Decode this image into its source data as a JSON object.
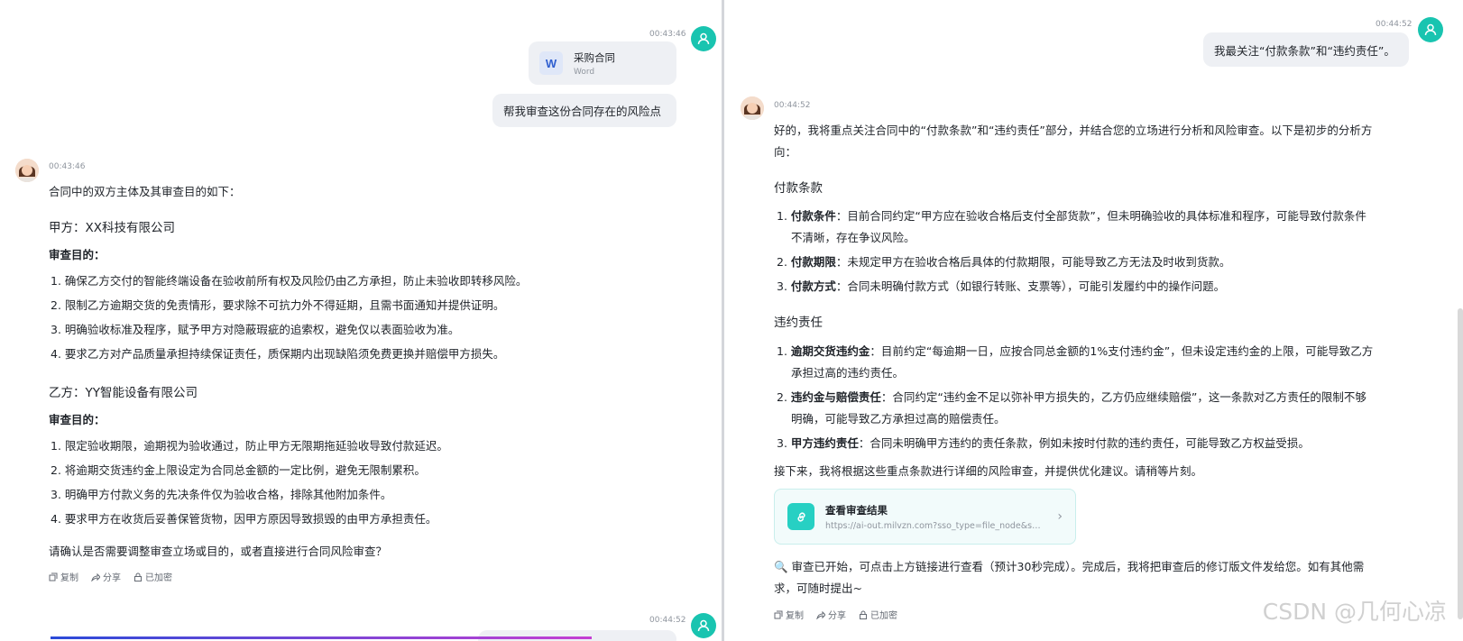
{
  "left": {
    "user_time_1": "00:43:46",
    "file": {
      "icon_letter": "W",
      "name": "采购合同",
      "type": "Word"
    },
    "user_message": "帮我审查这份合同存在的风险点",
    "bot_time": "00:43:46",
    "intro": "合同中的双方主体及其审查目的如下：",
    "party_a": {
      "heading": "甲方：XX科技有限公司",
      "purpose_label": "审查目的：",
      "items": [
        "确保乙方交付的智能终端设备在验收前所有权及风险仍由乙方承担，防止未验收即转移风险。",
        "限制乙方逾期交货的免责情形，要求除不可抗力外不得延期，且需书面通知并提供证明。",
        "明确验收标准及程序，赋予甲方对隐蔽瑕疵的追索权，避免仅以表面验收为准。",
        "要求乙方对产品质量承担持续保证责任，质保期内出现缺陷须免费更换并赔偿甲方损失。"
      ]
    },
    "party_b": {
      "heading": "乙方：YY智能设备有限公司",
      "purpose_label": "审查目的：",
      "items": [
        "限定验收期限，逾期视为验收通过，防止甲方无限期拖延验收导致付款延迟。",
        "将逾期交货违约金上限设定为合同总金额的一定比例，避免无限制累积。",
        "明确甲方付款义务的先决条件仅为验收合格，排除其他附加条件。",
        "要求甲方在收货后妥善保管货物，因甲方原因导致损毁的由甲方承担责任。"
      ]
    },
    "closing": "请确认是否需要调整审查立场或目的，或者直接进行合同风险审查？",
    "actions": {
      "copy": "复制",
      "share": "分享",
      "encrypted": "已加密"
    },
    "user_time_2": "00:44:52"
  },
  "right": {
    "user_time": "00:44:52",
    "user_message": "我最关注“付款条款”和“违约责任”。",
    "bot_time": "00:44:52",
    "intro_line1": "好的，我将重点关注合同中的“付款条款”和“违约责任”部分，并结合您的立场进行分析和风险审查。以下是初步的分析方",
    "intro_line2": "向：",
    "section1": {
      "heading": "付款条款",
      "items": [
        {
          "label": "付款条件",
          "line1": "：目前合同约定“甲方应在验收合格后支付全部货款”，但未明确验收的具体标准和程序，可能导致付款条件",
          "line2": "不清晰，存在争议风险。"
        },
        {
          "label": "付款期限",
          "line1": "：未规定甲方在验收合格后具体的付款期限，可能导致乙方无法及时收到货款。",
          "line2": ""
        },
        {
          "label": "付款方式",
          "line1": "：合同未明确付款方式（如银行转账、支票等），可能引发履约中的操作问题。",
          "line2": ""
        }
      ]
    },
    "section2": {
      "heading": "违约责任",
      "items": [
        {
          "label": "逾期交货违约金",
          "line1": "：目前约定“每逾期一日，应按合同总金额的1%支付违约金”，但未设定违约金的上限，可能导致乙方",
          "line2": "承担过高的违约责任。"
        },
        {
          "label": "违约金与赔偿责任",
          "line1": "：合同约定“违约金不足以弥补甲方损失的，乙方仍应继续赔偿”，这一条款对乙方责任的限制不够",
          "line2": "明确，可能导致乙方承担过高的赔偿责任。"
        },
        {
          "label": "甲方违约责任",
          "line1": "：合同未明确甲方违约的责任条款，例如未按时付款的违约责任，可能导致乙方权益受损。",
          "line2": ""
        }
      ]
    },
    "next_step": "接下来，我将根据这些重点条款进行详细的风险审查，并提供优化建议。请稍等片刻。",
    "link_card": {
      "title": "查看审查结果",
      "url": "https://ai-out.milvzn.com?sso_type=file_node&secre..."
    },
    "status_line1": "🔍 审查已开始，可点击上方链接进行查看（预计30秒完成）。完成后，我将把审查后的修订版文件发给您。如有其他需",
    "status_line2": "求，可随时提出~",
    "actions": {
      "copy": "复制",
      "share": "分享",
      "encrypted": "已加密"
    }
  },
  "watermark": "CSDN @几何心凉",
  "colors": {
    "accent": "#19c4b0",
    "link_icon": "#27d0c3",
    "bubble": "#eef0f4"
  }
}
